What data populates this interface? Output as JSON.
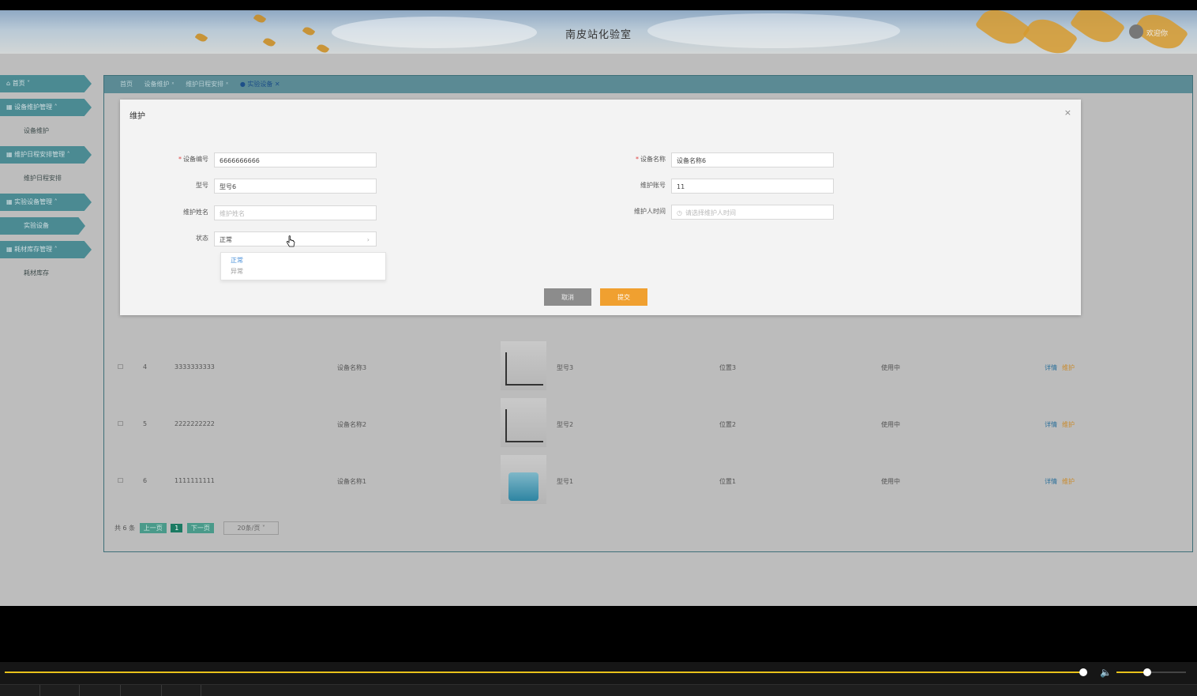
{
  "header": {
    "title": "南皮站化验室",
    "welcome": "欢迎你"
  },
  "sidebar": {
    "items": [
      {
        "label": "首页 ˅",
        "type": "head"
      },
      {
        "label": "设备维护管理 ˄",
        "type": "head"
      },
      {
        "label": "设备维护",
        "type": "sub"
      },
      {
        "label": "维护日程安排管理 ˄",
        "type": "head"
      },
      {
        "label": "维护日程安排",
        "type": "sub"
      },
      {
        "label": "实验设备管理 ˄",
        "type": "head"
      },
      {
        "label": "实验设备",
        "type": "sub-active"
      },
      {
        "label": "耗材库存管理 ˄",
        "type": "head"
      },
      {
        "label": "耗材库存",
        "type": "sub"
      }
    ]
  },
  "tabs": [
    "首页",
    "设备维护 ˣ",
    "维护日程安排 ˣ",
    "● 实验设备 ✕"
  ],
  "table": {
    "rows": [
      {
        "index": "4",
        "code": "3333333333",
        "name": "设备名称3",
        "model": "型号3",
        "location": "位置3",
        "status": "使用中",
        "detail": "详情",
        "maintain": "维护"
      },
      {
        "index": "5",
        "code": "2222222222",
        "name": "设备名称2",
        "model": "型号2",
        "location": "位置2",
        "status": "使用中",
        "detail": "详情",
        "maintain": "维护"
      },
      {
        "index": "6",
        "code": "1111111111",
        "name": "设备名称1",
        "model": "型号1",
        "location": "位置1",
        "status": "使用中",
        "detail": "详情",
        "maintain": "维护"
      }
    ]
  },
  "pager": {
    "total": "共 6 条",
    "prev": "上一页",
    "page": "1",
    "next": "下一页",
    "size": "20条/页"
  },
  "dialog": {
    "title": "维护",
    "close": "×",
    "fields": {
      "device_code": {
        "label": "设备编号",
        "value": "6666666666"
      },
      "device_name": {
        "label": "设备名称",
        "value": "设备名称6"
      },
      "model": {
        "label": "型号",
        "value": "型号6"
      },
      "maint_account": {
        "label": "维护账号",
        "value": "11"
      },
      "maint_name": {
        "label": "维护姓名",
        "placeholder": "维护姓名"
      },
      "maint_time": {
        "label": "维护人时间",
        "placeholder": "请选择维护人时间"
      },
      "status": {
        "label": "状态",
        "value": "正常",
        "options": [
          "正常",
          "异常"
        ]
      }
    },
    "cancel": "取消",
    "submit": "提交"
  },
  "colors": {
    "accent": "#f0a030",
    "sidebar": "#4b8a92",
    "link": "#2b6f9a",
    "progress": "#e8c21b"
  },
  "player": {
    "progress": 0.9,
    "volume": 0.45
  }
}
